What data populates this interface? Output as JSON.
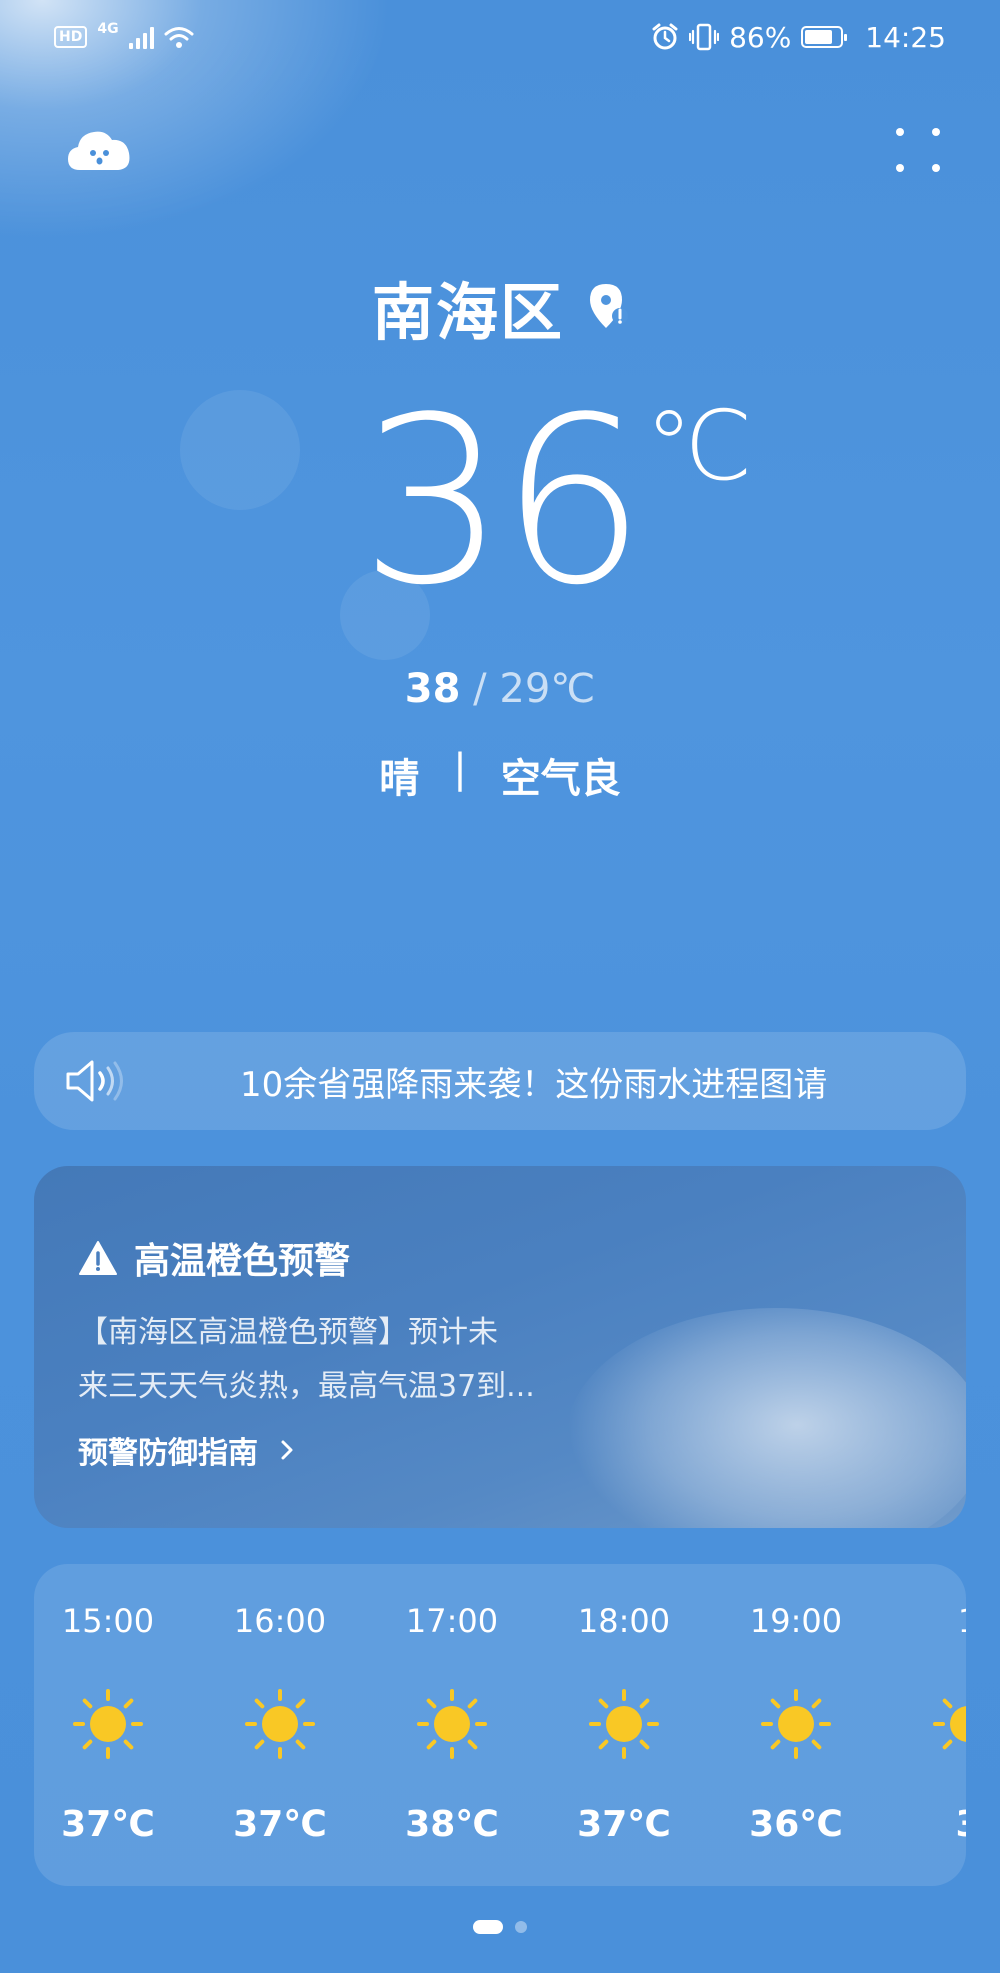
{
  "status_bar": {
    "hd": "HD",
    "network": "4G",
    "battery": "86%",
    "battery_level": 0.86,
    "time": "14:25",
    "icons": [
      "hd-icon",
      "signal-icon",
      "wifi-icon",
      "alarm-icon",
      "vibrate-icon",
      "battery-saver-icon"
    ]
  },
  "header": {
    "left_icon": "cloud-face-icon",
    "right_icon": "more-dots-icon"
  },
  "location": {
    "name": "南海区",
    "icon": "location-pin-icon"
  },
  "current": {
    "temp": "36",
    "unit": "℃",
    "high": "38",
    "low_text": " / 29℃",
    "condition": "晴",
    "separator": "|",
    "air": "空气良"
  },
  "news": {
    "icon": "speaker-icon",
    "text": "10余省强降雨来袭！这份雨水进程图请"
  },
  "warning": {
    "icon": "warning-triangle-icon",
    "title": "高温橙色预警",
    "body_line1": "【南海区高温橙色预警】预计未",
    "body_line2": "来三天天气炎热，最高气温37到...",
    "guide": "预警防御指南",
    "guide_icon": "chevron-right-icon"
  },
  "hourly": [
    {
      "time": "15:00",
      "icon": "sun-icon",
      "temp": "37℃"
    },
    {
      "time": "16:00",
      "icon": "sun-icon",
      "temp": "37℃"
    },
    {
      "time": "17:00",
      "icon": "sun-icon",
      "temp": "38℃"
    },
    {
      "time": "18:00",
      "icon": "sun-icon",
      "temp": "37℃"
    },
    {
      "time": "19:00",
      "icon": "sun-icon",
      "temp": "36℃"
    },
    {
      "time": "1",
      "icon": "sun-icon",
      "temp": "3"
    }
  ],
  "pager": {
    "pages": 2,
    "active": 1
  },
  "colors": {
    "background": "#4a90da",
    "sun": "#f9c825"
  }
}
